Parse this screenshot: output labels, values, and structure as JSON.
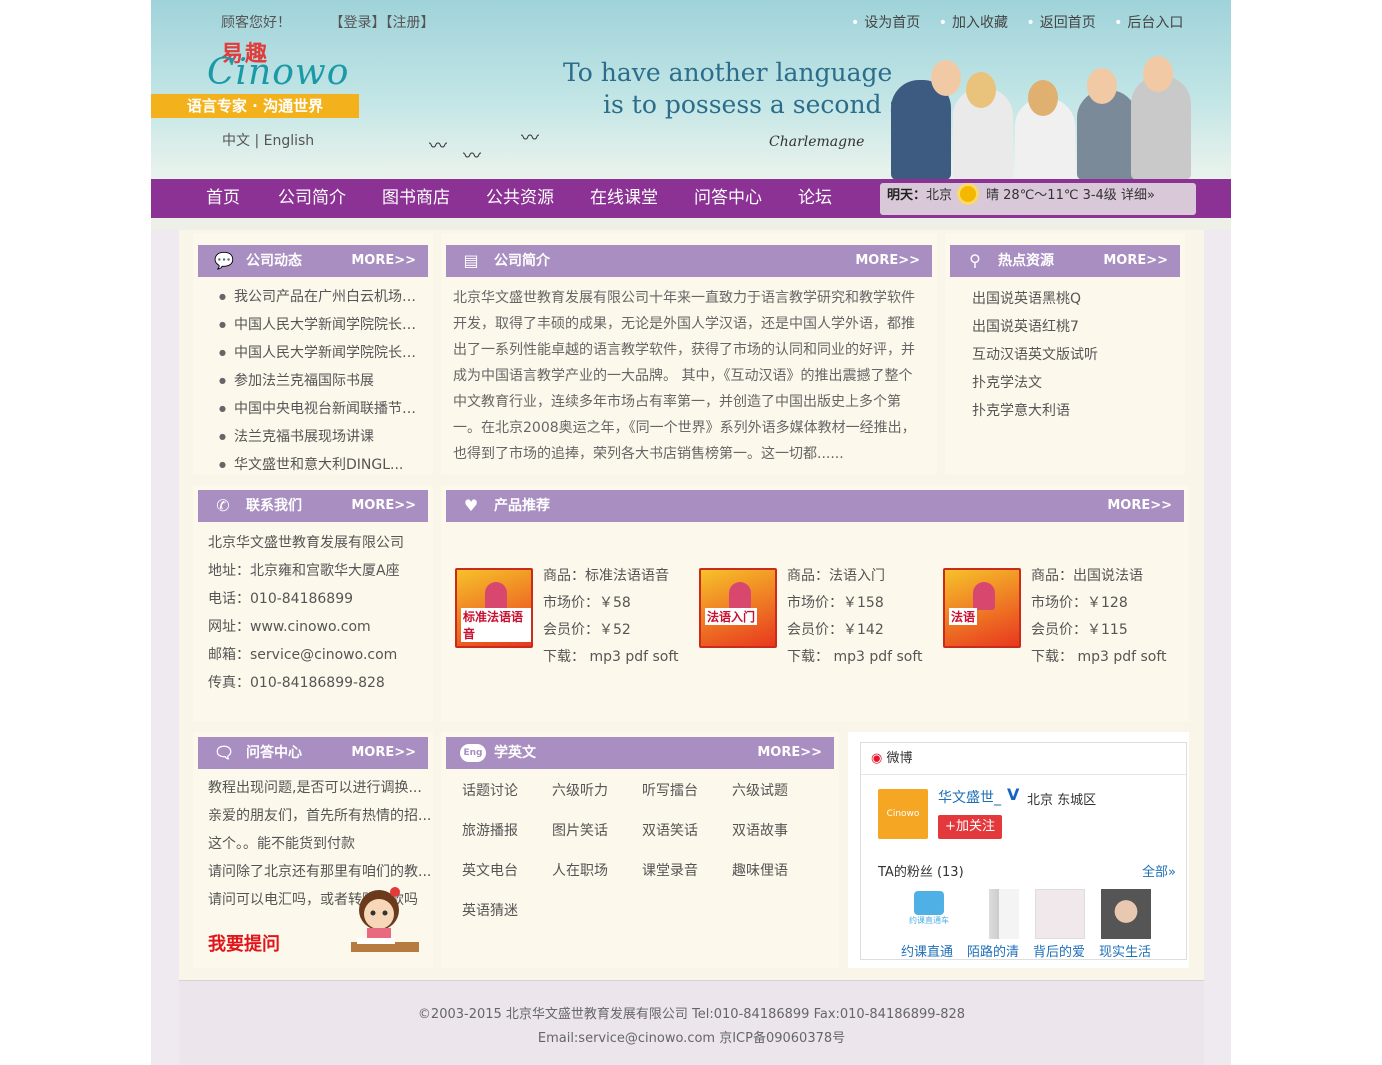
{
  "header": {
    "greeting": "顾客您好！",
    "login": "【登录】",
    "register": "【注册】",
    "links": [
      "设为首页",
      "加入收藏",
      "返回首页",
      "后台入口"
    ],
    "logo_cn": "易趣",
    "logo_en": "Cinowo",
    "slogan": "语言专家 · 沟通世界",
    "lang_switch": "中文 | English",
    "quote_line1": "To have another language",
    "quote_line2": "is to possess a second soul.",
    "quote_sign": "Charlemagne"
  },
  "nav": {
    "items": [
      "首页",
      "公司简介",
      "图书商店",
      "公共资源",
      "在线课堂",
      "问答中心",
      "论坛"
    ]
  },
  "weather": {
    "label": "明天：",
    "city": "北京",
    "desc": "晴  28℃～11℃  3-4级  详细»"
  },
  "more_label": "MORE>>",
  "news": {
    "title": "公司动态",
    "items": [
      "我公司产品在广州白云机场免税店上架",
      "中国人民大学新闻学院院长（...",
      "中国人民大学新闻学院院长（...",
      "参加法兰克福国际书展",
      "中国中央电视台新闻联播节目报道",
      "法兰克福书展现场讲课",
      "华文盛世和意大利DINGL..."
    ]
  },
  "about": {
    "title": "公司简介",
    "text": "北京华文盛世教育发展有限公司十年来一直致力于语言教学研究和教学软件开发，取得了丰硕的成果，无论是外国人学汉语，还是中国人学外语，都推出了一系列性能卓越的语言教学软件，获得了市场的认同和同业的好评，并成为中国语言教学产业的一大品牌。 其中，《互动汉语》的推出震撼了整个中文教育行业，连续多年市场占有率第一，并创造了中国出版史上多个第一。在北京2008奥运之年，《同一个世界》系列外语多媒体教材一经推出，也得到了市场的追捧，荣列各大书店销售榜第一。这一切都......"
  },
  "hot": {
    "title": "热点资源",
    "items": [
      "出国说英语黑桃Q",
      "出国说英语红桃7",
      "互动汉语英文版试听",
      "扑克学法文",
      "扑克学意大利语"
    ]
  },
  "contact": {
    "title": "联系我们",
    "lines": [
      "北京华文盛世教育发展有限公司",
      "地址：北京雍和宫歌华大厦A座",
      "电话：010-84186899",
      "网址：www.cinowo.com",
      "邮箱：service@cinowo.com",
      "传真：010-84186899-828"
    ]
  },
  "products": {
    "title": "产品推荐",
    "items": [
      {
        "name": "商品：标准法语语音",
        "market": "市场价：￥58",
        "member": "会员价：￥52",
        "download": "下载：  mp3   pdf   soft",
        "cover": "标准法语语音"
      },
      {
        "name": "商品：法语入门",
        "market": "市场价：￥158",
        "member": "会员价：￥142",
        "download": "下载：  mp3   pdf   soft",
        "cover": "法语入门"
      },
      {
        "name": "商品：出国说法语",
        "market": "市场价：￥128",
        "member": "会员价：￥115",
        "download": "下载：  mp3   pdf   soft",
        "cover": "法语"
      }
    ]
  },
  "qa": {
    "title": "问答中心",
    "items": [
      "教程出现问题,是否可以进行调换...",
      "亲爱的朋友们，首先所有热情的招...",
      "这个。。能不能货到付款",
      "请问除了北京还有那里有咱们的教...",
      "请问可以电汇吗，或者转账汇款吗"
    ],
    "ask": "我要提问"
  },
  "learn": {
    "title": "学英文",
    "badge": "Eng",
    "items": [
      "话题讨论",
      "六级听力",
      "听写擂台",
      "六级试题",
      "旅游播报",
      "图片笑话",
      "双语笑话",
      "双语故事",
      "英文电台",
      "人在职场",
      "课堂录音",
      "趣味俚语",
      "英语猜迷"
    ]
  },
  "weibo": {
    "title": "微博",
    "name": "华文盛世_",
    "location": "北京 东城区",
    "follow": "+加关注",
    "fans_label": "TA的粉丝 (13)",
    "all": "全部»",
    "fans": [
      "约课直通",
      "陌路的清",
      "背后的爱",
      "现实生活"
    ],
    "fan1_logo": "约课直通车"
  },
  "footer": {
    "line1": "©2003-2015    北京华文盛世教育发展有限公司     Tel:010-84186899 Fax:010-84186899-828",
    "line2": "Email:service@cinowo.com      京ICP备09060378号"
  },
  "colors": {
    "nav": "#8c3295",
    "panel_head": "#a98ec1",
    "slogan": "#f3b21b",
    "ask": "#e0151b"
  }
}
